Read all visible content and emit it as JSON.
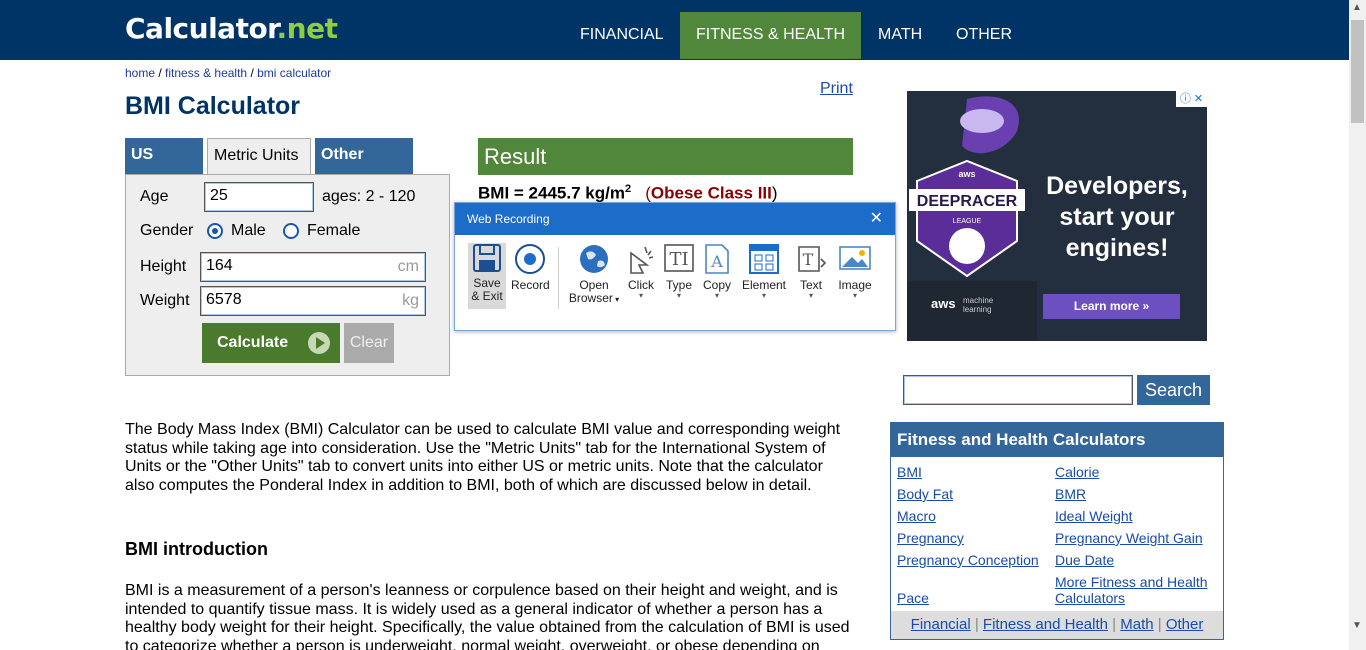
{
  "header": {
    "logo_main": "Calculator",
    "logo_dot": ".",
    "logo_net": "net",
    "nav": [
      "FINANCIAL",
      "FITNESS & HEALTH",
      "MATH",
      "OTHER"
    ],
    "active_nav": "FITNESS & HEALTH"
  },
  "breadcrumb": {
    "home": "home",
    "sep": " / ",
    "fitness": "fitness & health",
    "current": "bmi calculator"
  },
  "page": {
    "title": "BMI Calculator",
    "print": "Print"
  },
  "tabs": [
    "US Units",
    "Metric Units",
    "Other Units"
  ],
  "active_tab": "Metric Units",
  "form": {
    "age_label": "Age",
    "age_value": "25",
    "age_hint": "ages: 2 - 120",
    "gender_label": "Gender",
    "male_label": "Male",
    "female_label": "Female",
    "gender_selected": "Male",
    "height_label": "Height",
    "height_value": "164",
    "height_unit": "cm",
    "weight_label": "Weight",
    "weight_value": "6578",
    "weight_unit": "kg",
    "calculate_label": "Calculate",
    "clear_label": "Clear"
  },
  "result": {
    "heading": "Result",
    "bmi_prefix": "BMI = 2445.7 kg/m",
    "bmi_sup": "2",
    "open_paren": "(",
    "classification": "Obese Class III",
    "close_paren": ")"
  },
  "recorder": {
    "title": "Web Recording",
    "close": "✕",
    "tools": [
      {
        "label1": "Save",
        "label2": "& Exit",
        "icon": "save-icon"
      },
      {
        "label1": "Record",
        "label2": "",
        "icon": "record-icon"
      },
      {
        "label1": "Open",
        "label2": "Browser",
        "icon": "globe-icon"
      },
      {
        "label1": "Click",
        "label2": "",
        "icon": "click-icon"
      },
      {
        "label1": "Type",
        "label2": "",
        "icon": "type-icon"
      },
      {
        "label1": "Copy",
        "label2": "",
        "icon": "copy-icon"
      },
      {
        "label1": "Element",
        "label2": "",
        "icon": "element-icon"
      },
      {
        "label1": "Text",
        "label2": "",
        "icon": "text-icon"
      },
      {
        "label1": "Image",
        "label2": "",
        "icon": "image-icon"
      }
    ]
  },
  "ad": {
    "headline": "Developers, start your engines!",
    "button": "Learn more »",
    "brand": "aws",
    "sub1": "machine",
    "sub2": "learning",
    "badge_brand": "aws",
    "badge_name": "DEEPRACER",
    "badge_sub": "LEAGUE",
    "info": "ⓘ ✕"
  },
  "search": {
    "value": "",
    "button": "Search"
  },
  "sidebar": {
    "heading": "Fitness and Health Calculators",
    "links_left": [
      "BMI",
      "Body Fat",
      "Macro",
      "Pregnancy",
      "Pregnancy Conception",
      "Pace"
    ],
    "links_right": [
      "Calorie",
      "BMR",
      "Ideal Weight",
      "Pregnancy Weight Gain",
      "Due Date",
      "More Fitness and Health Calculators"
    ],
    "footer": [
      "Financial",
      "Fitness and Health",
      "Math",
      "Other"
    ],
    "footer_sep": " | "
  },
  "content": {
    "intro": "The Body Mass Index (BMI) Calculator can be used to calculate BMI value and corresponding weight status while taking age into consideration. Use the \"Metric Units\" tab for the International System of Units or the \"Other Units\" tab to convert units into either US or metric units. Note that the calculator also computes the Ponderal Index in addition to BMI, both of which are discussed below in detail.",
    "h2": "BMI introduction",
    "para2": "BMI is a measurement of a person's leanness or corpulence based on their height and weight, and is intended to quantify tissue mass. It is widely used as a general indicator of whether a person has a healthy body weight for their height. Specifically, the value obtained from the calculation of BMI is used to categorize whether a person is underweight, normal weight, overweight, or obese depending on"
  },
  "colors": {
    "brand_navy": "#003366",
    "accent_green": "#51873a",
    "tab_blue": "#336699",
    "recorder_blue": "#1c6cc9",
    "obese_red": "#8b0000"
  }
}
